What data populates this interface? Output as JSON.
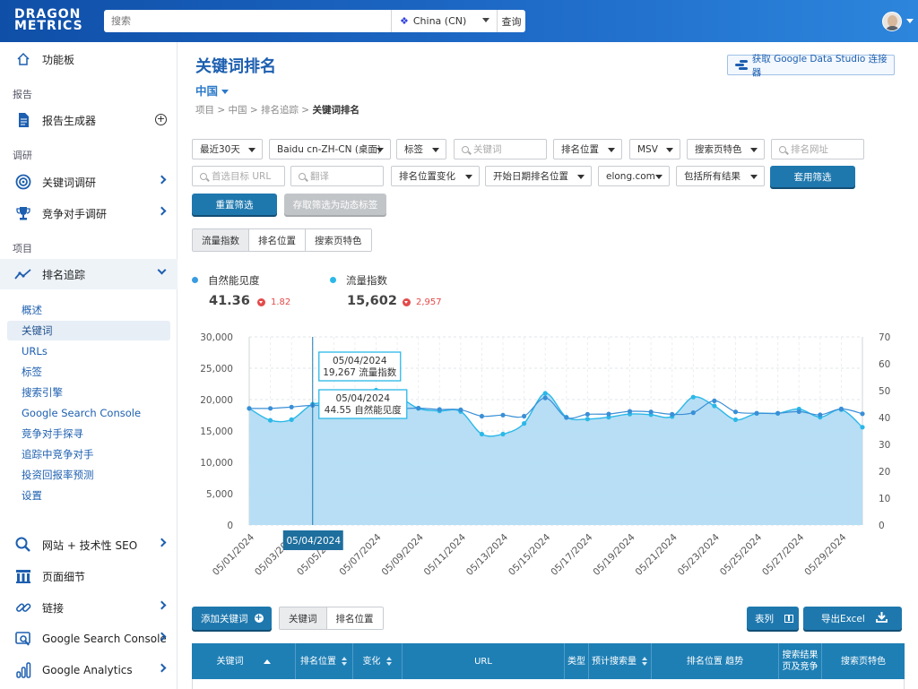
{
  "app": {
    "logo_line1": "DRAGON",
    "logo_line2": "METRICS"
  },
  "topbar": {
    "search_placeholder": "搜索",
    "region": "China (CN)",
    "search_button": "查询"
  },
  "sidebar": {
    "dashboard": "功能板",
    "section_reports": "报告",
    "report_builder": "报告生成器",
    "section_research": "调研",
    "keyword_research": "关键词调研",
    "competitor_research": "竞争对手调研",
    "section_project": "项目",
    "rank_tracking": "排名追踪",
    "sub_items": [
      "概述",
      "关键词",
      "URLs",
      "标签",
      "搜索引擎",
      "Google Search Console",
      "竞争对手探寻",
      "追踪中竞争对手",
      "投资回报率预测",
      "设置"
    ],
    "active_sub_index": 1,
    "site_seo": "网站 + 技术性 SEO",
    "page_details": "页面细节",
    "links": "链接",
    "google_search_console": "Google Search Console",
    "google_analytics": "Google Analytics"
  },
  "header": {
    "title": "关键词排名",
    "country": "中国",
    "breadcrumb": [
      "项目",
      "中国",
      "排名追踪",
      "关键词排名"
    ],
    "gds_button": "获取 Google Data Studio 连接器"
  },
  "filters": {
    "date_range": "最近30天",
    "engine": "Baidu cn-ZH-CN (桌面)",
    "tags": "标签",
    "keyword_placeholder": "关键词",
    "rank_position": "排名位置",
    "msv": "MSV",
    "serp_features": "搜索页特色",
    "rank_url_placeholder": "排名网址",
    "preferred_url_placeholder": "首选目标 URL",
    "translate_placeholder": "翻译",
    "rank_change": "排名位置变化",
    "start_rank": "开始日期排名位置",
    "domain": "elong.com",
    "include_all": "包括所有结果",
    "apply": "套用筛选",
    "reset": "重置筛选",
    "save_dynamic": "存取筛选为动态标签"
  },
  "chart_tabs": [
    "流量指数",
    "排名位置",
    "搜索页特色"
  ],
  "active_chart_tab": 0,
  "metrics": {
    "visibility": {
      "label": "自然能见度",
      "value": "41.36",
      "delta": "1.82",
      "color": "#3a9be0"
    },
    "traffic": {
      "label": "流量指数",
      "value": "15,602",
      "delta": "2,957",
      "color": "#2bb8e8"
    }
  },
  "chart_data": {
    "type": "area",
    "x": [
      "05/01/2024",
      "05/02/2024",
      "05/03/2024",
      "05/04/2024",
      "05/05/2024",
      "05/06/2024",
      "05/07/2024",
      "05/08/2024",
      "05/09/2024",
      "05/10/2024",
      "05/11/2024",
      "05/12/2024",
      "05/13/2024",
      "05/14/2024",
      "05/15/2024",
      "05/16/2024",
      "05/17/2024",
      "05/18/2024",
      "05/19/2024",
      "05/20/2024",
      "05/21/2024",
      "05/22/2024",
      "05/23/2024",
      "05/24/2024",
      "05/25/2024",
      "05/26/2024",
      "05/27/2024",
      "05/28/2024",
      "05/29/2024",
      "05/30/2024"
    ],
    "x_tick_labels": [
      "05/01/2024",
      "05/03/2024",
      "05/05/2024",
      "05/07/2024",
      "05/09/2024",
      "05/11/2024",
      "05/13/2024",
      "05/15/2024",
      "05/17/2024",
      "05/19/2024",
      "05/21/2024",
      "05/23/2024",
      "05/25/2024",
      "05/27/2024",
      "05/29/2024"
    ],
    "series": [
      {
        "name": "流量指数",
        "axis": "left",
        "values": [
          18600,
          16700,
          16800,
          19267,
          19200,
          19000,
          21500,
          20600,
          18600,
          18200,
          18100,
          14500,
          14500,
          16200,
          21000,
          17200,
          16900,
          17200,
          17700,
          17600,
          17300,
          20400,
          19000,
          16800,
          17800,
          17800,
          18500,
          17200,
          18400,
          15600
        ]
      },
      {
        "name": "自然能见度",
        "axis": "right",
        "values": [
          43.4,
          43.4,
          43.9,
          44.55,
          44.2,
          44.0,
          43.9,
          43.3,
          43.5,
          43.0,
          42.9,
          40.5,
          40.9,
          40.5,
          47.3,
          40.0,
          41.2,
          41.3,
          42.3,
          42.1,
          41.2,
          41.8,
          46.2,
          42.1,
          41.6,
          41.6,
          42.2,
          41.0,
          43.2,
          41.4
        ]
      }
    ],
    "y_left": {
      "ticks": [
        "0",
        "5,000",
        "10,000",
        "15,000",
        "20,000",
        "25,000",
        "30,000"
      ],
      "min": 0,
      "max": 30000
    },
    "y_right": {
      "ticks": [
        "0",
        "10",
        "20",
        "30",
        "40",
        "50",
        "60",
        "70"
      ],
      "min": 0,
      "max": 70
    },
    "tooltip_traffic": {
      "date": "05/04/2024",
      "text": "19,267 流量指数"
    },
    "tooltip_visibility": {
      "date": "05/04/2024",
      "text": "44.55 自然能见度"
    },
    "crosshair_label": "05/04/2024",
    "highlight_index": 3
  },
  "table_controls": {
    "add_keyword": "添加关键词",
    "view_tabs": [
      "关键词",
      "排名位置"
    ],
    "columns_btn": "表列",
    "export_btn": "导出Excel"
  },
  "table": {
    "columns": [
      "关键词",
      "排名位置",
      "变化",
      "URL",
      "类型",
      "预计搜索量",
      "排名位置 趋势",
      "搜索结果页及竞争",
      "搜索页特色"
    ]
  }
}
